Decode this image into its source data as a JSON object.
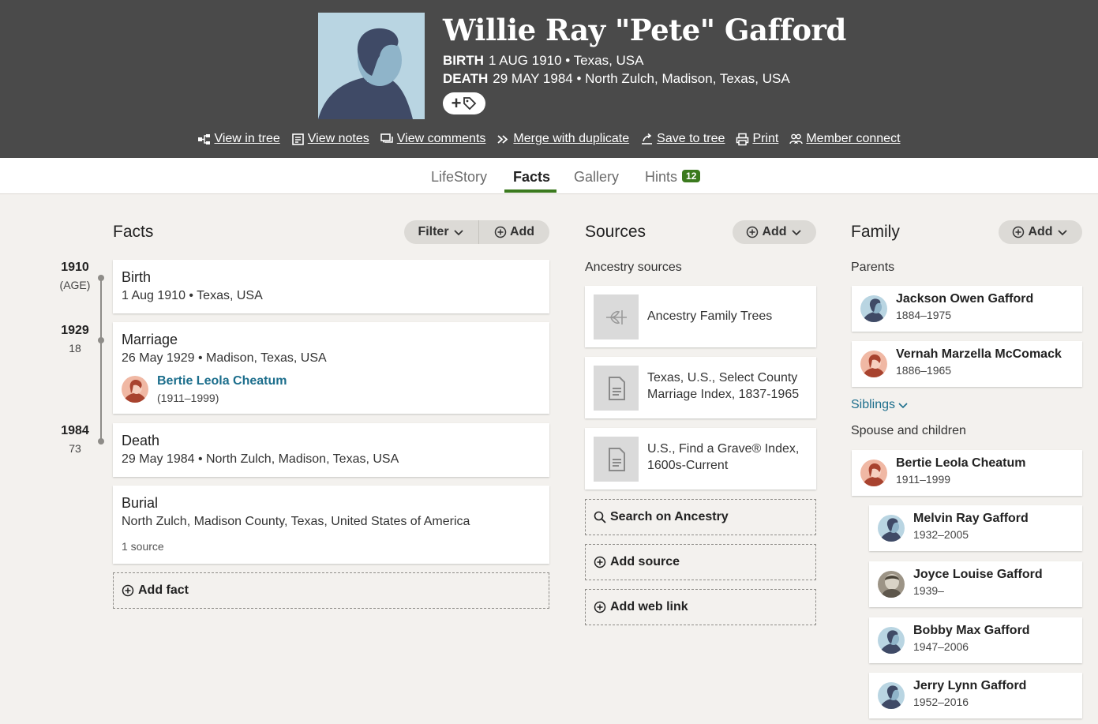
{
  "person": {
    "name": "Willie Ray \"Pete\" Gafford",
    "birth_label": "BIRTH",
    "birth_value": "1 AUG 1910 • Texas, USA",
    "death_label": "DEATH",
    "death_value": "29 MAY 1984 • North Zulch, Madison, Texas, USA"
  },
  "actions": [
    {
      "label": "View in tree",
      "icon": "tree-icon"
    },
    {
      "label": "View notes",
      "icon": "notes-icon"
    },
    {
      "label": "View comments",
      "icon": "comments-icon"
    },
    {
      "label": "Merge with duplicate",
      "icon": "merge-icon"
    },
    {
      "label": "Save to tree",
      "icon": "save-icon"
    },
    {
      "label": "Print",
      "icon": "print-icon"
    },
    {
      "label": "Member connect",
      "icon": "members-icon"
    }
  ],
  "tabs": {
    "lifestory": "LifeStory",
    "facts": "Facts",
    "gallery": "Gallery",
    "hints": "Hints",
    "hints_count": "12"
  },
  "facts": {
    "title": "Facts",
    "filter": "Filter",
    "add": "Add",
    "timeline": [
      {
        "year": "1910",
        "age": "(AGE)"
      },
      {
        "year": "1929",
        "age": "18"
      },
      {
        "year": "1984",
        "age": "73"
      }
    ],
    "items": [
      {
        "title": "Birth",
        "detail": "1 Aug 1910 • Texas, USA"
      },
      {
        "title": "Marriage",
        "detail": "26 May 1929 • Madison, Texas, USA",
        "spouse": "Bertie Leola Cheatum",
        "spouse_years": "(1911–1999)"
      },
      {
        "title": "Death",
        "detail": "29 May 1984 • North Zulch, Madison, Texas, USA"
      },
      {
        "title": "Burial",
        "detail": "North Zulch, Madison County, Texas, United States of America",
        "sources": "1 source"
      }
    ],
    "add_fact": "Add fact"
  },
  "sources": {
    "title": "Sources",
    "add": "Add",
    "subtitle": "Ancestry sources",
    "items": [
      {
        "line1": "Ancestry Family Trees",
        "line2": "",
        "icon": "family-tree-leaf-icon"
      },
      {
        "line1": "Texas, U.S., Select County",
        "line2": "Marriage Index, 1837-1965",
        "icon": "document-icon"
      },
      {
        "line1": "U.S., Find a Grave® Index,",
        "line2": "1600s-Current",
        "icon": "document-icon"
      }
    ],
    "search": "Search on Ancestry",
    "add_source": "Add source",
    "add_web_link": "Add web link"
  },
  "family": {
    "title": "Family",
    "add": "Add",
    "parents_label": "Parents",
    "parents": [
      {
        "name": "Jackson Owen Gafford",
        "years": "1884–1975",
        "gender": "male"
      },
      {
        "name": "Vernah Marzella McComack",
        "years": "1886–1965",
        "gender": "female"
      }
    ],
    "siblings_label": "Siblings",
    "spouse_children_label": "Spouse and children",
    "spouse": {
      "name": "Bertie Leola Cheatum",
      "years": "1911–1999",
      "gender": "female"
    },
    "children": [
      {
        "name": "Melvin Ray Gafford",
        "years": "1932–2005",
        "gender": "male"
      },
      {
        "name": "Joyce Louise Gafford",
        "years": "1939–",
        "gender": "photo"
      },
      {
        "name": "Bobby Max Gafford",
        "years": "1947–2006",
        "gender": "male"
      },
      {
        "name": "Jerry Lynn Gafford",
        "years": "1952–2016",
        "gender": "male"
      }
    ]
  },
  "colors": {
    "header_bg": "#4a4a4a",
    "accent_green": "#3b7a1e",
    "link_blue": "#1c6e8c",
    "page_bg": "#f3f1ee"
  }
}
